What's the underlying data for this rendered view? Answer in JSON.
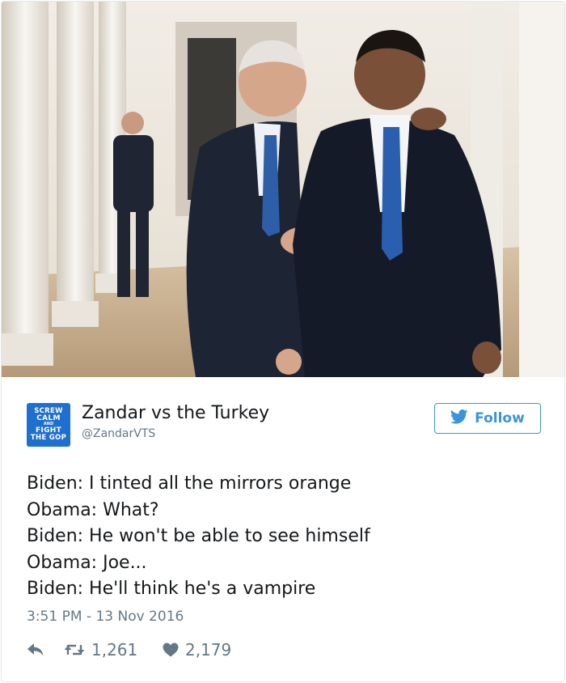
{
  "photo": {
    "description_icon": "photo-of-two-men-walking-in-colonnade"
  },
  "user": {
    "avatar_lines": [
      "SCREW",
      "CALM",
      "AND",
      "FIGHT",
      "THE GOP"
    ],
    "display_name": "Zandar vs the Turkey",
    "handle": "@ZandarVTS"
  },
  "follow": {
    "label": "Follow",
    "icon": "twitter-bird-icon",
    "color": "#3b94d9"
  },
  "tweet": {
    "lines": [
      "Biden: I tinted all the mirrors orange",
      "Obama: What?",
      "Biden: He won't be able to see himself",
      "Obama: Joe...",
      "Biden: He'll think he's a vampire"
    ],
    "timestamp": "3:51 PM - 13 Nov 2016"
  },
  "actions": {
    "reply_icon": "reply-icon",
    "retweet_icon": "retweet-icon",
    "retweet_count": "1,261",
    "like_icon": "heart-icon",
    "like_count": "2,179"
  }
}
